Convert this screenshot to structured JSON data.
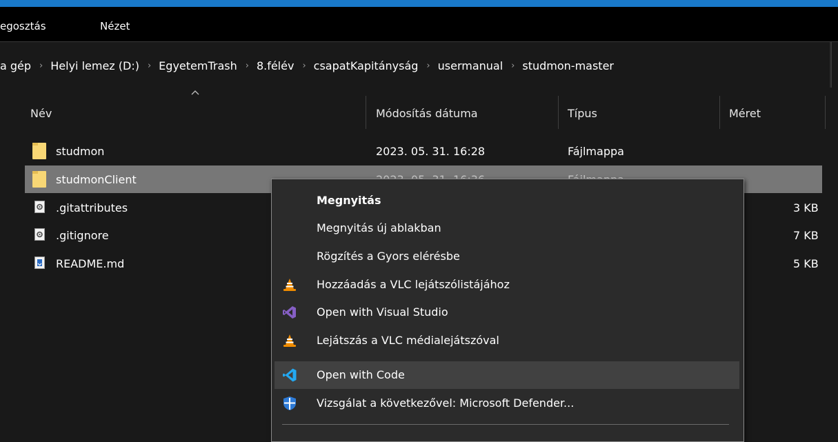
{
  "ribbon": {
    "tabs": [
      "egosztás",
      "Nézet"
    ]
  },
  "breadcrumb": [
    "a gép",
    "Helyi lemez (D:)",
    "EgyetemTrash",
    "8.félév",
    "csapatKapitányság",
    "usermanual",
    "studmon-master"
  ],
  "columns": {
    "name": "Név",
    "modified": "Módosítás dátuma",
    "type": "Típus",
    "size": "Méret"
  },
  "files": [
    {
      "name": "studmon",
      "modified": "2023. 05. 31. 16:28",
      "type": "Fájlmappa",
      "size": "",
      "icon": "folder-icon"
    },
    {
      "name": "studmonClient",
      "modified": "2023. 05. 31. 16:36",
      "type": "Fájlmappa",
      "size": "",
      "icon": "folder-icon",
      "selected": true
    },
    {
      "name": ".gitattributes",
      "modified": "",
      "type": "",
      "size": "3 KB",
      "icon": "gear-file-icon"
    },
    {
      "name": ".gitignore",
      "modified": "",
      "type": "",
      "size": "7 KB",
      "icon": "gear-file-icon"
    },
    {
      "name": "README.md",
      "modified": "",
      "type": "",
      "size": "5 KB",
      "icon": "markdown-file-icon"
    }
  ],
  "context_menu": {
    "items": [
      {
        "label": "Megnyitás",
        "bold": true,
        "icon": ""
      },
      {
        "label": "Megnyitás új ablakban",
        "icon": ""
      },
      {
        "label": "Rögzítés a Gyors elérésbe",
        "icon": ""
      },
      {
        "label": "Hozzáadás a VLC lejátszólistájához",
        "icon": "vlc-cone-icon"
      },
      {
        "label": "Open with Visual Studio",
        "icon": "visual-studio-icon"
      },
      {
        "label": "Lejátszás a VLC médialejátszóval",
        "icon": "vlc-cone-icon"
      },
      {
        "label": "Open with Code",
        "icon": "vscode-icon",
        "hover": true
      },
      {
        "label": "Vizsgálat a következővel: Microsoft Defender...",
        "icon": "defender-shield-icon"
      }
    ]
  },
  "colors": {
    "accent": "#1979ca",
    "background": "#191919",
    "selected_row": "#777777",
    "menu_bg": "#2b2b2b",
    "menu_hover": "#414141",
    "folder": "#f8d775",
    "vlc_orange": "#f08c00",
    "vs_purple": "#865fc5",
    "vscode_blue": "#23a9f2",
    "defender_blue": "#2d7ad6"
  }
}
